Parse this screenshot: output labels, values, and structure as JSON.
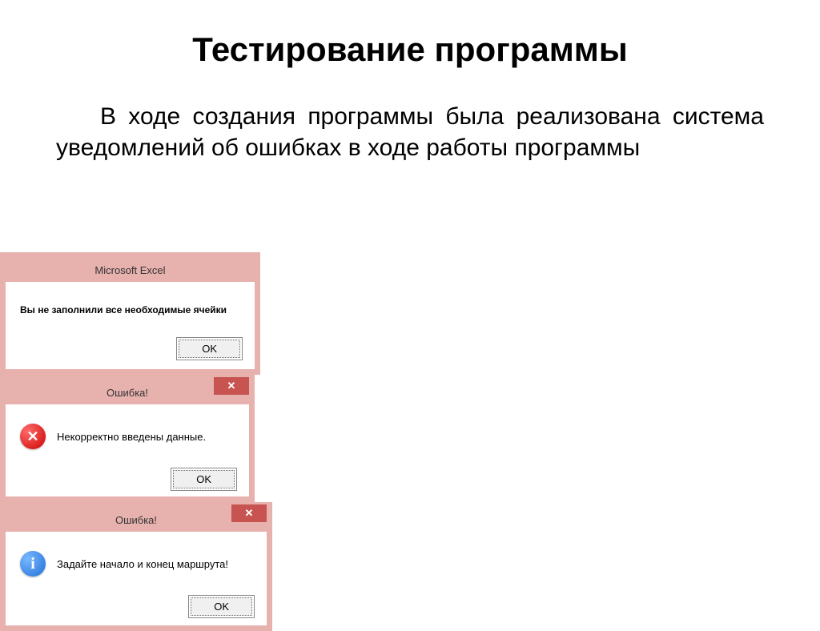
{
  "slide": {
    "title": "Тестирование программы",
    "paragraph": "В ходе создания программы была реализована система уведомлений об ошибках в ходе работы программы"
  },
  "dialog1": {
    "title": "Microsoft Excel",
    "message": "Вы не заполнили все необходимые ячейки",
    "ok": "OK"
  },
  "dialog2": {
    "title": "Ошибка!",
    "message": "Некорректно введены данные.",
    "ok": "OK",
    "close": "✕"
  },
  "dialog3": {
    "title": "Ошибка!",
    "message": "Задайте начало и конец маршрута!",
    "ok": "OK",
    "close": "✕"
  }
}
